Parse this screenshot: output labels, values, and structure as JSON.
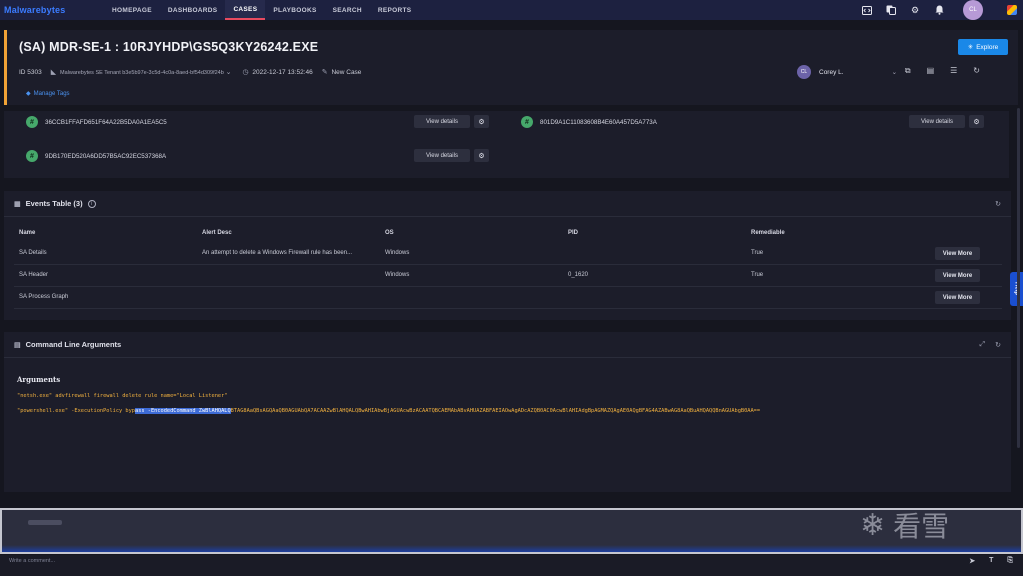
{
  "nav": {
    "logo": "Malwarebytes",
    "items": [
      {
        "label": "HOMEPAGE",
        "active": false
      },
      {
        "label": "DASHBOARDS",
        "active": false
      },
      {
        "label": "CASES",
        "active": true
      },
      {
        "label": "PLAYBOOKS",
        "active": false
      },
      {
        "label": "SEARCH",
        "active": false
      },
      {
        "label": "REPORTS",
        "active": false
      }
    ],
    "avatar": "CL",
    "icons": [
      "code-icon",
      "copy-icon",
      "gear-icon",
      "bell-icon",
      "app-icon"
    ]
  },
  "case": {
    "title": "(SA) MDR-SE-1 : 10RJYHDP\\GS5Q3KY26242.EXE",
    "explore_label": "Explore",
    "id": "ID 5303",
    "tenant": "Malwarebytes SE Tenant b3e5b97e-3c5d-4c0a-8aed-bf54d309f24b",
    "datetime": "2022-12-17 13:52:46",
    "status": "New Case",
    "manage_tags": "Manage Tags",
    "assignee_initials": "CL",
    "assignee_name": "Corey L."
  },
  "hashes": [
    {
      "value": "36CCB1FFAFD651F64A22B5DA0A1EA5C5",
      "button": "View details"
    },
    {
      "value": "801D9A1C11083608B4E60A457D5A773A",
      "button": "View details"
    },
    {
      "value": "9DB170ED520A6DD57B5AC92EC537368A",
      "button": "View details"
    }
  ],
  "events": {
    "title": "Events Table (3)",
    "columns": [
      "Name",
      "Alert Desc",
      "OS",
      "PID",
      "Remediable"
    ],
    "rows": [
      {
        "name": "SA Details",
        "desc": "An attempt to delete a Windows Firewall rule has been...",
        "os": "Windows",
        "pid": "",
        "remediable": "True",
        "button": "View More"
      },
      {
        "name": "SA Header",
        "desc": "",
        "os": "Windows",
        "pid": "0_1620",
        "remediable": "True",
        "button": "View More"
      },
      {
        "name": "SA Process Graph",
        "desc": "",
        "os": "",
        "pid": "",
        "remediable": "",
        "button": "View More"
      }
    ]
  },
  "cmd": {
    "title": "Command Line Arguments",
    "args_label": "Arguments",
    "line1": "\"netsh.exe\" advfirewall firewall delete rule name=\"Local Listener\"",
    "line2_pre": "\"powershell.exe\" -ExecutionPolicy byp",
    "line2_sel": "ass -EncodedCommand ZwBlAHQALQ",
    "line2_post": "BTAG8AaQBsAGQAaQB0AGUAbQA7ACAAZwBlAHQALQBwAHIAbwBjAGUAcwBzACAATQBCAEMAbABvAHUAZABFAEIAOwAgADcAZQB0AC0AcwBlAHIAdgBpAGMAZQAgAE0AQgBFAG4AZABwAG8AaQBuAHQAQQBnAGUAbgB0AA=="
  },
  "comment": {
    "placeholder": "Write a comment..."
  },
  "watermark": "看雪",
  "help_label": "Help"
}
